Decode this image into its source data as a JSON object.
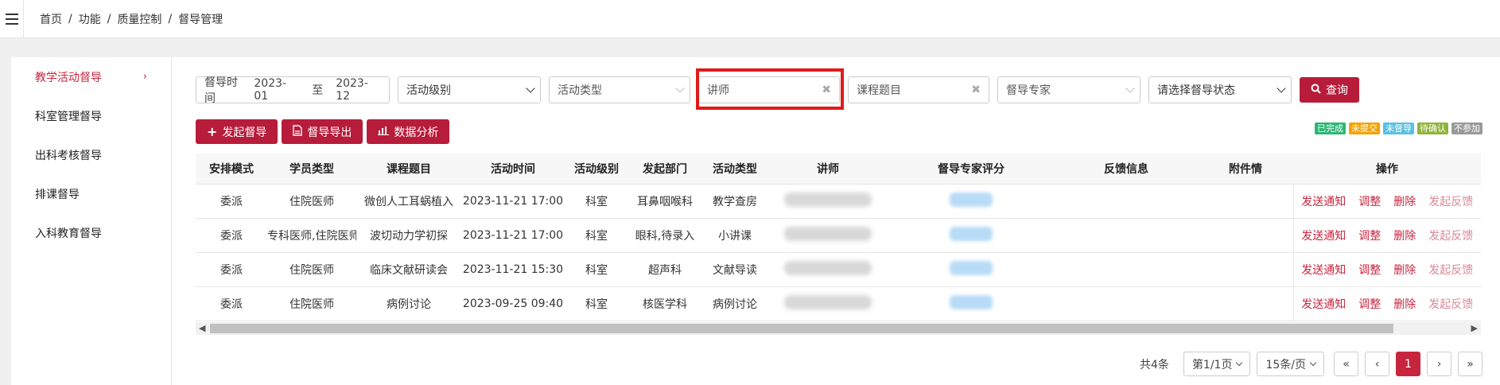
{
  "breadcrumb": [
    "首页",
    "功能",
    "质量控制",
    "督导管理"
  ],
  "sidebar": {
    "items": [
      {
        "label": "教学活动督导",
        "active": true
      },
      {
        "label": "科室管理督导"
      },
      {
        "label": "出科考核督导"
      },
      {
        "label": "排课督导"
      },
      {
        "label": "入科教育督导"
      }
    ]
  },
  "filters": {
    "time_label": "督导时间",
    "time_start": "2023-01",
    "time_to": "至",
    "time_end": "2023-12",
    "level": "活动级别",
    "type": "活动类型",
    "teacher": "讲师",
    "topic": "课程题目",
    "expert": "督导专家",
    "status": "请选择督导状态",
    "query_label": "查询"
  },
  "actions": {
    "start": "发起督导",
    "export": "督导导出",
    "analysis": "数据分析"
  },
  "legend": [
    {
      "label": "已完成",
      "color": "#2bb673"
    },
    {
      "label": "未提交",
      "color": "#f0a30a"
    },
    {
      "label": "未督导",
      "color": "#5bc0de"
    },
    {
      "label": "待确认",
      "color": "#8fb33b"
    },
    {
      "label": "不参加",
      "color": "#999999"
    }
  ],
  "table": {
    "headers": [
      "安排模式",
      "学员类型",
      "课程题目",
      "活动时间",
      "活动级别",
      "发起部门",
      "活动类型",
      "讲师",
      "督导专家评分",
      "反馈信息",
      "附件情",
      "操作"
    ],
    "rows": [
      {
        "mode": "委派",
        "student": "住院医师",
        "topic": "微创人工耳蜗植入",
        "time": "2023-11-21 17:00",
        "level": "科室",
        "dept": "耳鼻咽喉科",
        "type": "教学查房"
      },
      {
        "mode": "委派",
        "student": "专科医师,住院医师",
        "topic": "波切动力学初探",
        "time": "2023-11-21 17:00",
        "level": "科室",
        "dept": "眼科,待录入",
        "type": "小讲课"
      },
      {
        "mode": "委派",
        "student": "住院医师",
        "topic": "临床文献研读会",
        "time": "2023-11-21 15:30",
        "level": "科室",
        "dept": "超声科",
        "type": "文献导读"
      },
      {
        "mode": "委派",
        "student": "住院医师",
        "topic": "病例讨论",
        "time": "2023-09-25 09:40",
        "level": "科室",
        "dept": "核医学科",
        "type": "病例讨论"
      }
    ],
    "ops": [
      "发送通知",
      "调整",
      "删除",
      "发起反馈"
    ]
  },
  "pager": {
    "total": "共4条",
    "page_select": "第1/1页",
    "size_select": "15条/页",
    "first": "«",
    "prev": "‹",
    "current": "1",
    "next": "›",
    "last": "»"
  }
}
